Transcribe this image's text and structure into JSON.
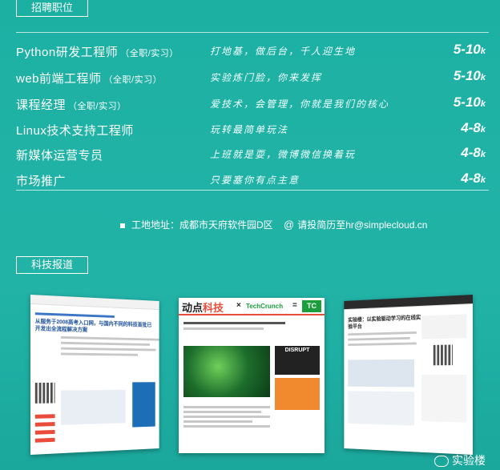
{
  "jobs_section": {
    "tag": "招聘职位",
    "rows": [
      {
        "title": "Python研发工程师",
        "type": "（全职/实习）",
        "slogan": "打地基，做后台，千人迎生地",
        "salary": "5-10",
        "unit": "k"
      },
      {
        "title": "web前端工程师",
        "type": "（全职/实习）",
        "slogan": "实验炼门脸，你来发挥",
        "salary": "5-10",
        "unit": "k"
      },
      {
        "title": "课程经理",
        "type": "（全职/实习）",
        "slogan": "爱技术，会管理，你就是我们的核心",
        "salary": "5-10",
        "unit": "k"
      },
      {
        "title": "Linux技术支持工程师",
        "type": "",
        "slogan": "玩转最简单玩法",
        "salary": "4-8",
        "unit": "k"
      },
      {
        "title": "新媒体运营专员",
        "type": "",
        "slogan": "上班就是耍，微博微信换着玩",
        "salary": "4-8",
        "unit": "k"
      },
      {
        "title": "市场推广",
        "type": "",
        "slogan": "只要塞你有点主意",
        "salary": "4-8",
        "unit": "k"
      }
    ]
  },
  "contact": {
    "address": "工地地址：成都市天府软件园D区",
    "email": "请投简历至hr@simplecloud.cn",
    "at_symbol": "@"
  },
  "news_section": {
    "tag": "科技报道",
    "thumb1_title": "从服务于2008高考入口网，与国内不同的科技首批已开发出全流程解决方案",
    "thumb2_logo": "动点",
    "thumb2_logo_accent": "科技",
    "thumb2_partner": "TechCrunch",
    "thumb2_x": "×",
    "thumb2_eq": "=",
    "thumb2_tc": "TC",
    "thumb2_disrupt": "DISRUPT",
    "thumb3_title": "实验楼：以实验驱动学习的在线实验平台"
  },
  "watermark": "实验楼",
  "colors": {
    "background": "#1eb0a4",
    "text": "#ffffff"
  }
}
